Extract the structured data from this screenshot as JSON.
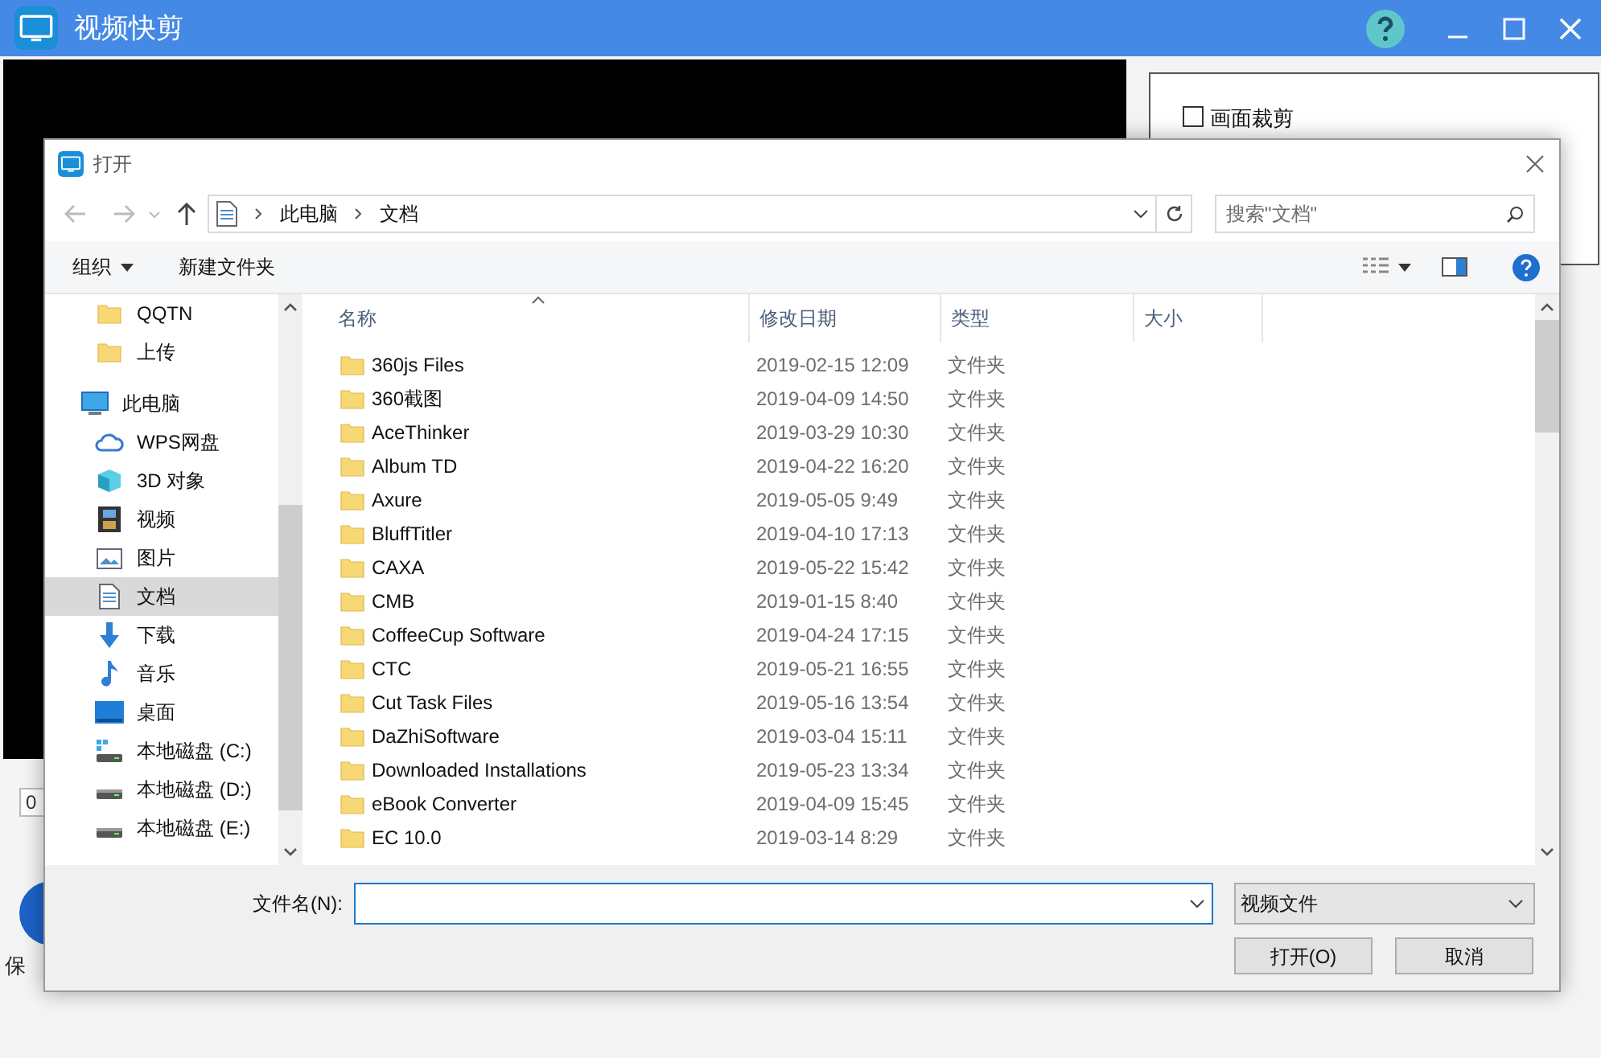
{
  "app": {
    "title": "视频快剪",
    "crop_option": {
      "label": "画面裁剪",
      "checked": false
    },
    "time_field": {
      "value": "0"
    },
    "save_label": "保"
  },
  "dialog": {
    "title": "打开",
    "breadcrumb": [
      "此电脑",
      "文档"
    ],
    "search": {
      "placeholder": "搜索\"文档\""
    },
    "toolbar": {
      "organize": "组织",
      "new_folder": "新建文件夹"
    },
    "nav": [
      {
        "children": [
          {
            "label": "QQTN",
            "kind": "folder",
            "selected": false
          },
          {
            "label": "上传",
            "kind": "folder",
            "selected": false
          }
        ]
      },
      {
        "label": "此电脑",
        "kind": "pc",
        "selected": false,
        "children": [
          {
            "label": "WPS网盘",
            "kind": "cloud",
            "selected": false
          },
          {
            "label": "3D 对象",
            "kind": "cube",
            "selected": false
          },
          {
            "label": "视频",
            "kind": "film",
            "selected": false
          },
          {
            "label": "图片",
            "kind": "image",
            "selected": false
          },
          {
            "label": "文档",
            "kind": "doc",
            "selected": true
          },
          {
            "label": "下载",
            "kind": "download",
            "selected": false
          },
          {
            "label": "音乐",
            "kind": "music",
            "selected": false
          },
          {
            "label": "桌面",
            "kind": "desktop",
            "selected": false
          },
          {
            "label": "本地磁盘 (C:)",
            "kind": "system_drive",
            "selected": false
          },
          {
            "label": "本地磁盘 (D:)",
            "kind": "drive",
            "selected": false
          },
          {
            "label": "本地磁盘 (E:)",
            "kind": "drive",
            "selected": false
          }
        ]
      }
    ],
    "columns": [
      {
        "label": "名称",
        "sorted": true
      },
      {
        "label": "修改日期",
        "sorted": false
      },
      {
        "label": "类型",
        "sorted": false
      },
      {
        "label": "大小",
        "sorted": false
      }
    ],
    "files": [
      {
        "name": "360js Files",
        "modified": "2019-02-15 12:09",
        "type": "文件夹"
      },
      {
        "name": "360截图",
        "modified": "2019-04-09 14:50",
        "type": "文件夹"
      },
      {
        "name": "AceThinker",
        "modified": "2019-03-29 10:30",
        "type": "文件夹"
      },
      {
        "name": "Album TD",
        "modified": "2019-04-22 16:20",
        "type": "文件夹"
      },
      {
        "name": "Axure",
        "modified": "2019-05-05 9:49",
        "type": "文件夹"
      },
      {
        "name": "BluffTitler",
        "modified": "2019-04-10 17:13",
        "type": "文件夹"
      },
      {
        "name": "CAXA",
        "modified": "2019-05-22 15:42",
        "type": "文件夹"
      },
      {
        "name": "CMB",
        "modified": "2019-01-15 8:40",
        "type": "文件夹"
      },
      {
        "name": "CoffeeCup Software",
        "modified": "2019-04-24 17:15",
        "type": "文件夹"
      },
      {
        "name": "CTC",
        "modified": "2019-05-21 16:55",
        "type": "文件夹"
      },
      {
        "name": "Cut Task Files",
        "modified": "2019-05-16 13:54",
        "type": "文件夹"
      },
      {
        "name": "DaZhiSoftware",
        "modified": "2019-03-04 15:11",
        "type": "文件夹"
      },
      {
        "name": "Downloaded Installations",
        "modified": "2019-05-23 13:34",
        "type": "文件夹"
      },
      {
        "name": "eBook Converter",
        "modified": "2019-04-09 15:45",
        "type": "文件夹"
      },
      {
        "name": "EC 10.0",
        "modified": "2019-03-14 8:29",
        "type": "文件夹"
      }
    ],
    "file_name": {
      "label": "文件名(N):"
    },
    "file_type": "视频文件",
    "buttons": [
      "打开(O)",
      "取消"
    ]
  }
}
